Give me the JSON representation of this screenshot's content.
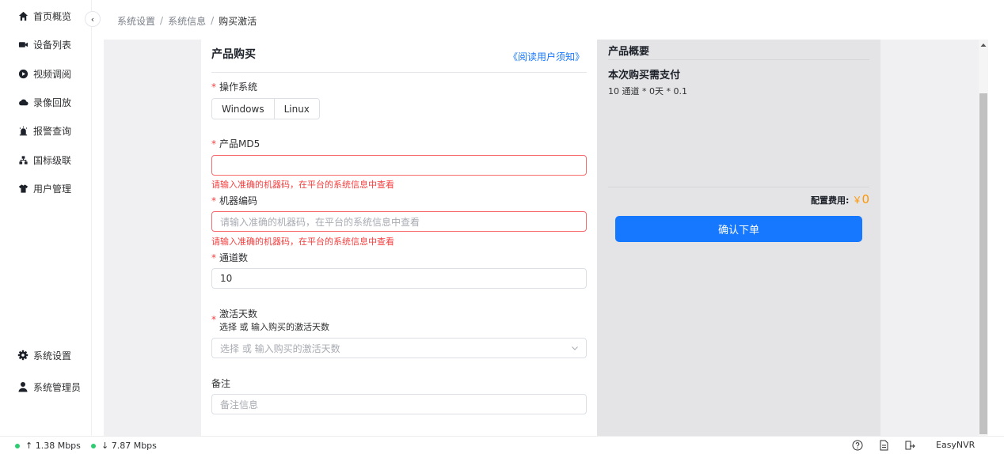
{
  "sidebar": {
    "items": [
      {
        "label": "首页概览",
        "icon": "home-icon"
      },
      {
        "label": "设备列表",
        "icon": "camera-icon"
      },
      {
        "label": "视频调阅",
        "icon": "play-icon"
      },
      {
        "label": "录像回放",
        "icon": "cloud-icon"
      },
      {
        "label": "报警查询",
        "icon": "alarm-icon"
      },
      {
        "label": "国标级联",
        "icon": "cascade-icon"
      },
      {
        "label": "用户管理",
        "icon": "shirt-icon"
      }
    ],
    "bottom_items": [
      {
        "label": "系统设置",
        "icon": "gear-icon"
      },
      {
        "label": "系统管理员",
        "icon": "user-icon"
      }
    ],
    "collapse_glyph": "‹"
  },
  "breadcrumb": {
    "items": [
      "系统设置",
      "系统信息",
      "购买激活"
    ],
    "separator": "/"
  },
  "form": {
    "title": "产品购买",
    "read_link": "《阅读用户须知》",
    "os_label": "操作系统",
    "os_options": [
      "Windows",
      "Linux"
    ],
    "md5_label": "产品MD5",
    "md5_value": "",
    "md5_error": "请输入准确的机器码，在平台的系统信息中查看",
    "machine_label": "机器编码",
    "machine_placeholder": "请输入准确的机器码，在平台的系统信息中查看",
    "machine_error": "请输入准确的机器码，在平台的系统信息中查看",
    "channels_label": "通道数",
    "channels_value": "10",
    "days_label": "激活天数",
    "days_sublabel": "选择 或 输入购买的激活天数",
    "days_placeholder": "选择 或 输入购买的激活天数",
    "remark_label": "备注",
    "remark_placeholder": "备注信息",
    "required_mark": "*"
  },
  "summary": {
    "title": "产品概要",
    "subtitle": "本次购买需支付",
    "calc": "10 通道 * 0天 * 0.1",
    "fee_label": "配置费用:",
    "fee_currency": "￥",
    "fee_value": "0",
    "confirm_label": "确认下单"
  },
  "statusbar": {
    "upload": "↑ 1.38 Mbps",
    "download": "↓ 7.87 Mbps",
    "brand": "EasyNVR"
  },
  "colors": {
    "primary": "#1677ff",
    "error": "#f53f3f",
    "fee": "#ff9500",
    "status_dot": "#2ecc71"
  }
}
